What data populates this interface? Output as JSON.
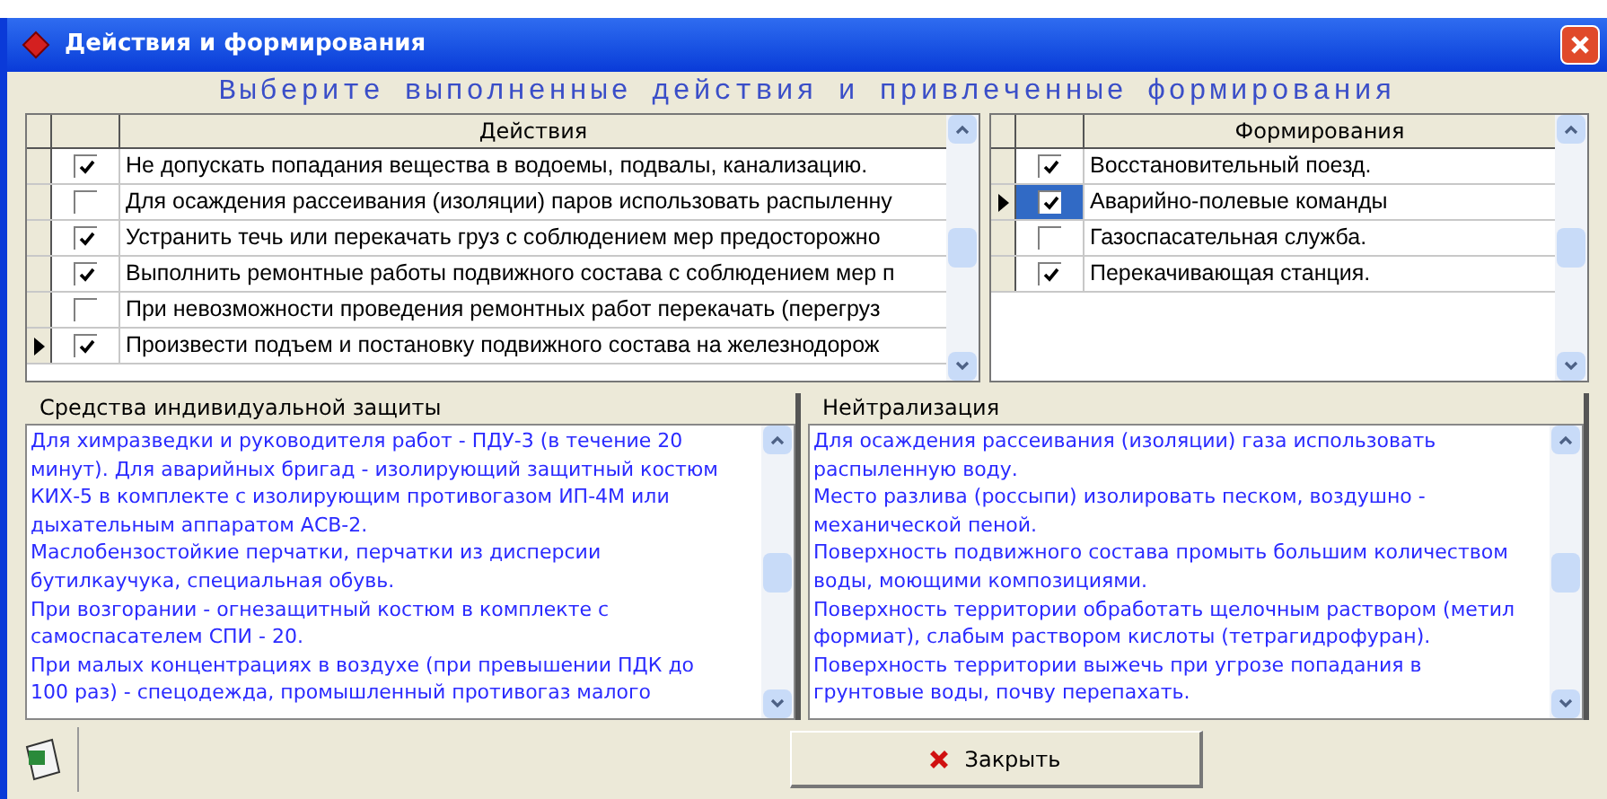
{
  "window": {
    "title": "Действия и формирования"
  },
  "heading": "Выберите выполненные действия и привлеченные формирования",
  "actions": {
    "column": "Действия",
    "rows": [
      {
        "text": "Не допускать попадания вещества в водоемы, подвалы, канализацию.",
        "checked": true,
        "current": false
      },
      {
        "text": "Для осаждения рассеивания (изоляции) паров использовать распыленну",
        "checked": false,
        "current": false
      },
      {
        "text": "Устранить течь или перекачать груз с соблюдением мер предосторожно",
        "checked": true,
        "current": false
      },
      {
        "text": "Выполнить ремонтные работы подвижного состава с соблюдением мер п",
        "checked": true,
        "current": false
      },
      {
        "text": "При невозможности проведения ремонтных работ перекачать (перегруз",
        "checked": false,
        "current": false
      },
      {
        "text": "Произвести подъем и постановку подвижного состава на железнодорож",
        "checked": true,
        "current": true
      }
    ]
  },
  "formations": {
    "column": "Формирования",
    "rows": [
      {
        "text": "Восстановительный поезд.",
        "checked": true,
        "current": false
      },
      {
        "text": "Аварийно-полевые команды",
        "checked": true,
        "current": true
      },
      {
        "text": "Газоспасательная служба.",
        "checked": false,
        "current": false
      },
      {
        "text": "Перекачивающая станция.",
        "checked": true,
        "current": false
      }
    ]
  },
  "protection": {
    "title": "Средства индивидуальной защиты",
    "lines": [
      "Для химразведки и руководителя работ - ПДУ-3 (в течение 20",
      "минут). Для аварийных бригад - изолирующий защитный костюм",
      "КИХ-5 в комплекте с изолирующим противогазом ИП-4М или",
      "дыхательным аппаратом АСВ-2.",
      "Маслобензостойкие перчатки, перчатки из дисперсии",
      "бутилкаучука, специальная обувь.",
      "При возгорании - огнезащитный костюм в комплекте с",
      "самоспасателем СПИ - 20.",
      "При малых концентрациях в воздухе (при превышении ПДК до",
      "100 раз) - спецодежда, промышленный противогаз малого"
    ]
  },
  "neutralization": {
    "title": "Нейтрализация",
    "lines": [
      "Для осаждения рассеивания (изоляции) газа использовать",
      "распыленную воду.",
      "Место разлива (россыпи) изолировать песком, воздушно -",
      "механической пеной.",
      "Поверхность подвижного состава промыть большим количеством",
      "воды, моющими композициями.",
      "Поверхность территории обработать щелочным раствором (метил",
      "формиат), слабым раствором кислоты (тетрагидрофуран).",
      "Поверхность территории выжечь при угрозе попадания в",
      "грунтовые воды, почву перепахать."
    ]
  },
  "close_button": "Закрыть"
}
